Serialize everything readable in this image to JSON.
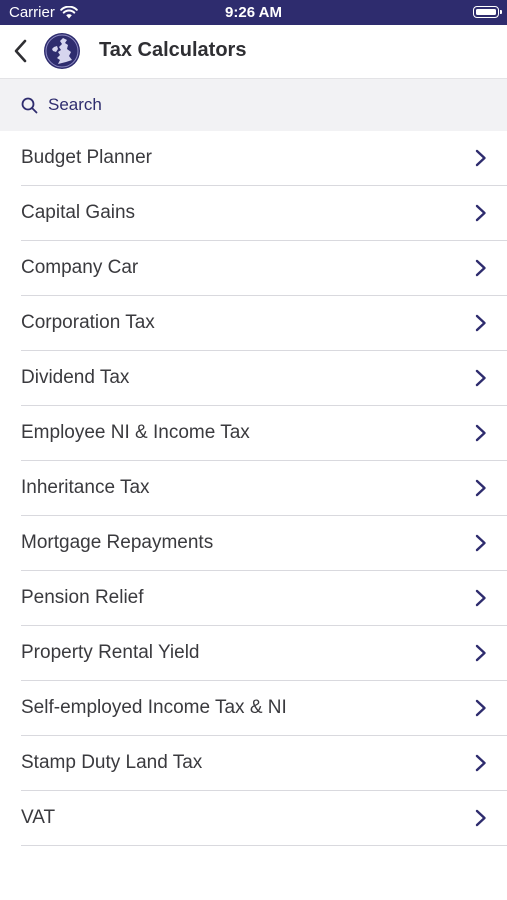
{
  "status_bar": {
    "carrier": "Carrier",
    "time": "9:26 AM"
  },
  "nav": {
    "title": "Tax Calculators"
  },
  "search": {
    "placeholder": "Search"
  },
  "items": [
    {
      "label": "Budget Planner"
    },
    {
      "label": "Capital Gains"
    },
    {
      "label": "Company Car"
    },
    {
      "label": "Corporation Tax"
    },
    {
      "label": "Dividend Tax"
    },
    {
      "label": "Employee NI & Income Tax"
    },
    {
      "label": "Inheritance Tax"
    },
    {
      "label": "Mortgage Repayments"
    },
    {
      "label": "Pension Relief"
    },
    {
      "label": "Property Rental Yield"
    },
    {
      "label": "Self-employed Income Tax & NI"
    },
    {
      "label": "Stamp Duty Land Tax"
    },
    {
      "label": "VAT"
    }
  ],
  "colors": {
    "brand": "#2e2c6e",
    "text": "#3a3a3e",
    "separator": "#d9d9de",
    "search_bg": "#f2f2f4"
  },
  "icons": {
    "back": "chevron-left-icon",
    "search": "search-icon",
    "row": "chevron-right-icon",
    "wifi": "wifi-icon",
    "battery": "battery-icon"
  }
}
